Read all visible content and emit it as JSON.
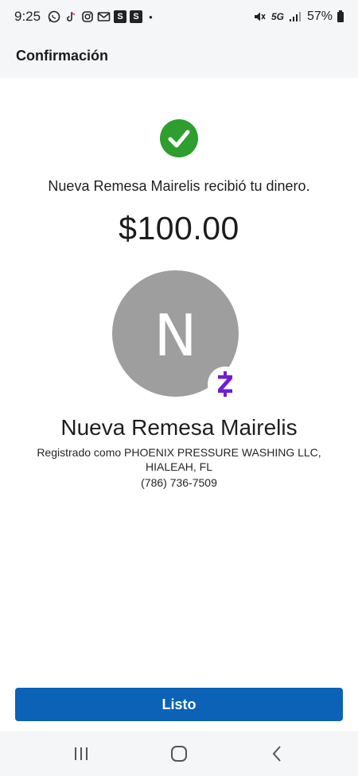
{
  "status_bar": {
    "time": "9:25",
    "icons_left": [
      "whatsapp-icon",
      "tiktok-icon",
      "instagram-icon",
      "gmail-icon",
      "s-app-icon",
      "s-app-icon",
      "notification-dot"
    ],
    "s_box_1": "S",
    "s_box_2": "S",
    "dot": "•",
    "network": "5G",
    "battery": "57%"
  },
  "header": {
    "title": "Confirmación"
  },
  "confirmation": {
    "status_icon": "check-circle-icon",
    "status_color": "#2e9e2e",
    "message": "Nueva Remesa Mairelis recibió tu dinero.",
    "amount": "$100.00"
  },
  "recipient": {
    "initial": "N",
    "avatar_color": "#9e9e9e",
    "badge_icon": "zelle-icon",
    "badge_color": "#6d1ed4",
    "name": "Nueva Remesa Mairelis",
    "registered": "Registrado como PHOENIX PRESSURE WASHING LLC, HIALEAH, FL",
    "phone": "(786) 736-7509"
  },
  "actions": {
    "done_label": "Listo",
    "accent": "#0b62b6"
  },
  "nav_bar": {
    "items": [
      "recent-apps-icon",
      "home-icon",
      "back-icon"
    ]
  }
}
